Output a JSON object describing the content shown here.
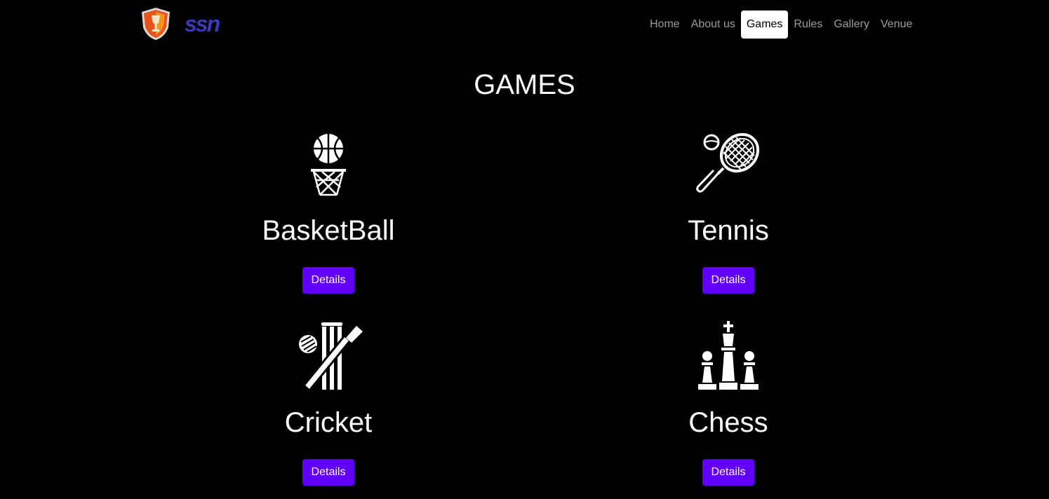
{
  "nav": {
    "logo_shield": "trophy-shield-logo",
    "logo_text": "ssn",
    "links": [
      {
        "label": "Home",
        "active": false
      },
      {
        "label": "About us",
        "active": false
      },
      {
        "label": "Games",
        "active": true
      },
      {
        "label": "Rules",
        "active": false
      },
      {
        "label": "Gallery",
        "active": false
      },
      {
        "label": "Venue",
        "active": false
      }
    ]
  },
  "page": {
    "title": "GAMES"
  },
  "games": [
    {
      "name": "BasketBall",
      "icon": "basketball-icon",
      "button": "Details"
    },
    {
      "name": "Tennis",
      "icon": "tennis-racket-icon",
      "button": "Details"
    },
    {
      "name": "Cricket",
      "icon": "cricket-icon",
      "button": "Details"
    },
    {
      "name": "Chess",
      "icon": "chess-icon",
      "button": "Details"
    }
  ],
  "colors": {
    "background": "#000000",
    "button": "#6200ff",
    "brand_text": "#3a3ab4",
    "nav_text": "#9a9a9a",
    "nav_active_bg": "#ffffff"
  }
}
